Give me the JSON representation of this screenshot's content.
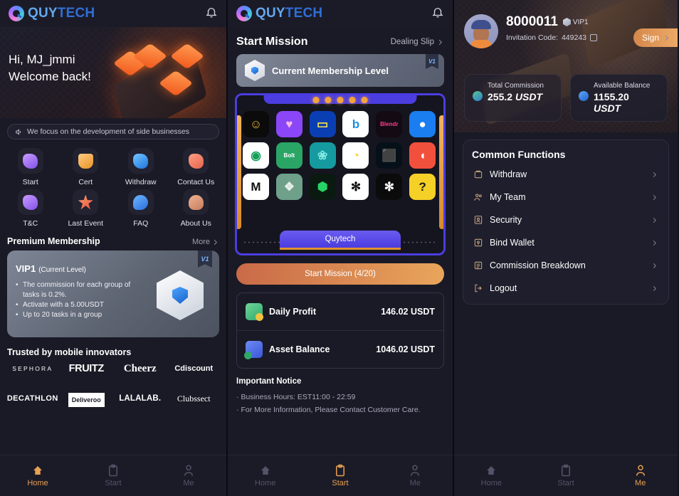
{
  "brand": {
    "name_part1": "QUY",
    "name_part2": "TECH",
    "accent": "#e8a055",
    "purple": "#4b3de0"
  },
  "tabbar": {
    "items": [
      {
        "label": "Home",
        "icon": "home-icon"
      },
      {
        "label": "Start",
        "icon": "clipboard-icon"
      },
      {
        "label": "Me",
        "icon": "person-icon"
      }
    ]
  },
  "home": {
    "greeting_line1": "Hi, MJ_jmmi",
    "greeting_line2": "Welcome back!",
    "marquee": "We focus on the development of side businesses",
    "quick_actions": [
      {
        "label": "Start",
        "icon": "document-icon"
      },
      {
        "label": "Cert",
        "icon": "certificate-icon"
      },
      {
        "label": "Withdraw",
        "icon": "withdraw-icon"
      },
      {
        "label": "Contact Us",
        "icon": "support-icon"
      },
      {
        "label": "T&C",
        "icon": "terms-icon"
      },
      {
        "label": "Last Event",
        "icon": "star-icon"
      },
      {
        "label": "FAQ",
        "icon": "question-icon"
      },
      {
        "label": "About Us",
        "icon": "people-icon"
      }
    ],
    "premium": {
      "title": "Premium Membership",
      "more": "More",
      "level": "VIP1",
      "level_note": "(Current Level)",
      "badge": "V1",
      "bullets": [
        "The commission for each group of tasks is 0.2%.",
        "Activate with a 5.00USDT",
        "Up to 20 tasks in a group"
      ]
    },
    "trusted": {
      "title": "Trusted by mobile innovators",
      "brands": [
        "SEPHORA",
        "FRUITZ",
        "Cheerz",
        "Cdiscount",
        "DECATHLON",
        "Deliveroo",
        "LALALAB.",
        "Clubssect"
      ]
    }
  },
  "start": {
    "title": "Start Mission",
    "dealing_slip": "Dealing Slip",
    "membership_card": {
      "label": "Current Membership Level",
      "badge": "V1"
    },
    "machine_label": "Quytech",
    "apps": [
      {
        "name": "bumble-icon",
        "bg": "#0b0b0b",
        "fg": "#f4c13a",
        "glyph": "☺"
      },
      {
        "name": "badoo-icon",
        "bg": "#8b46f7",
        "fg": "#f6b9e6",
        "glyph": "♥"
      },
      {
        "name": "tag-icon",
        "bg": "#0a3fb4",
        "fg": "#f7e14a",
        "glyph": "▭"
      },
      {
        "name": "bing-icon",
        "bg": "#ffffff",
        "fg": "#1b8fe8",
        "glyph": "b"
      },
      {
        "name": "blendr-icon",
        "bg": "#130a14",
        "fg": "#ff3d8a",
        "glyph": "Blendr"
      },
      {
        "name": "happn-icon",
        "bg": "#1a7df0",
        "fg": "#ffffff",
        "glyph": "●"
      },
      {
        "name": "mobile-app-icon",
        "bg": "#ffffff",
        "fg": "#13a05a",
        "glyph": "◉"
      },
      {
        "name": "bolt-icon",
        "bg": "#2aa566",
        "fg": "#ffffff",
        "glyph": "Bolt"
      },
      {
        "name": "flower-icon",
        "bg": "#159aa0",
        "fg": "#7fe8e0",
        "glyph": "❀"
      },
      {
        "name": "smiley-icon",
        "bg": "#ffffff",
        "fg": "#f7cf3f",
        "glyph": "◔"
      },
      {
        "name": "qrcode-icon",
        "bg": "#061018",
        "fg": "#3ef0e0",
        "glyph": "⬛"
      },
      {
        "name": "firefox-icon",
        "bg": "#f1503c",
        "fg": "#ffffff",
        "glyph": "◖"
      },
      {
        "name": "m-icon",
        "bg": "#ffffff",
        "fg": "#111111",
        "glyph": "M"
      },
      {
        "name": "cluster-icon",
        "bg": "#6ea08a",
        "fg": "#e6efe8",
        "glyph": "❖"
      },
      {
        "name": "hex-icon",
        "bg": "#0b1a10",
        "fg": "#25d366",
        "glyph": "⬢"
      },
      {
        "name": "openai-icon",
        "bg": "#ffffff",
        "fg": "#111111",
        "glyph": "✻"
      },
      {
        "name": "anthropic-icon",
        "bg": "#0b0b0b",
        "fg": "#ffffff",
        "glyph": "✻"
      },
      {
        "name": "question-icon",
        "bg": "#f5d026",
        "fg": "#1a1a1a",
        "glyph": "?"
      }
    ],
    "cta": "Start Mission  (4/20)",
    "stats": [
      {
        "label": "Daily Profit",
        "value": "146.02 USDT",
        "icon": "profit-chart-icon"
      },
      {
        "label": "Asset Balance",
        "value": "1046.02 USDT",
        "icon": "wallet-icon"
      }
    ],
    "notice": {
      "title": "Important Notice",
      "lines": [
        "Business Hours: EST11:00 - 22:59",
        "For More Information, Please Contact Customer Care."
      ]
    }
  },
  "me": {
    "user_id": "8000011",
    "vip_level": "VIP1",
    "invitation_label": "Invitation Code:",
    "invitation_code": "449243",
    "sign_button": "Sign",
    "balances": [
      {
        "label": "Total Commission",
        "value": "255.2",
        "unit": "USDT",
        "icon": "commission-icon"
      },
      {
        "label": "Available Balance",
        "value": "1155.20",
        "unit": "USDT",
        "icon": "balance-icon"
      }
    ],
    "common_functions": {
      "title": "Common Functions",
      "items": [
        {
          "label": "Withdraw",
          "icon": "withdraw-icon"
        },
        {
          "label": "My Team",
          "icon": "team-icon"
        },
        {
          "label": "Security",
          "icon": "security-icon"
        },
        {
          "label": "Bind Wallet",
          "icon": "wallet-bind-icon"
        },
        {
          "label": "Commission Breakdown",
          "icon": "list-icon"
        },
        {
          "label": "Logout",
          "icon": "logout-icon"
        }
      ]
    }
  }
}
